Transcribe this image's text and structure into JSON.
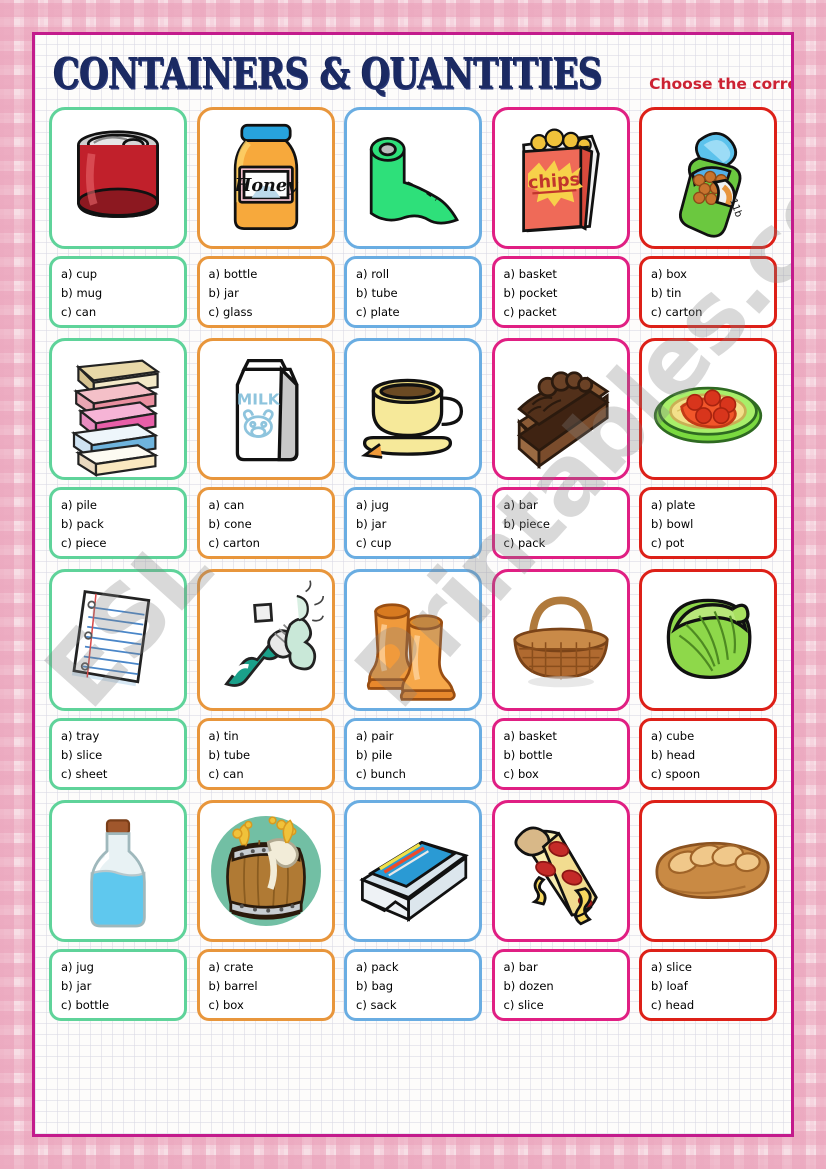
{
  "header": {
    "title": "CONTAINERS & QUANTITIES",
    "instruction": "Choose the correct option."
  },
  "watermark": {
    "left": "ESL",
    "right": "Printables.com"
  },
  "colors": {
    "title": "#1b2a63",
    "instruction": "#cc2233",
    "frame": "#c31b8c",
    "border_green": "#5fd39a",
    "border_orange": "#e8963c",
    "border_blue": "#6aade2",
    "border_pink": "#e01f83",
    "border_red": "#dd2018"
  },
  "rows": [
    {
      "cells": [
        {
          "border": "green",
          "picture": "red-can-icon",
          "picture_label": "red tin can with ring-pull lid",
          "options": [
            "a) cup",
            "b) mug",
            "c) can"
          ]
        },
        {
          "border": "orange",
          "picture": "honey-jar-icon",
          "picture_label": "honey jar with blue lid",
          "picture_text": "Honey",
          "options": [
            "a) bottle",
            "b) jar",
            "c) glass"
          ]
        },
        {
          "border": "blue",
          "picture": "toilet-roll-icon",
          "picture_label": "green roll of paper",
          "options": [
            "a) roll",
            "b) tube",
            "c) plate"
          ]
        },
        {
          "border": "pink",
          "picture": "chips-packet-icon",
          "picture_label": "open red packet of chips",
          "picture_text": "chips",
          "options": [
            "a) basket",
            "b) pocket",
            "c) packet"
          ]
        },
        {
          "border": "red",
          "picture": "open-bean-tin-icon",
          "picture_label": "opened green tin of beans",
          "options": [
            "a) box",
            "b) tin",
            "c) carton"
          ]
        }
      ]
    },
    {
      "cells": [
        {
          "border": "green",
          "picture": "stack-of-boxes-icon",
          "picture_label": "pile of stacked boxes",
          "options": [
            "a) pile",
            "b) pack",
            "c) piece"
          ]
        },
        {
          "border": "orange",
          "picture": "milk-carton-icon",
          "picture_label": "milk carton with cow face",
          "picture_text": "MILK",
          "options": [
            "a) can",
            "b) cone",
            "c) carton"
          ]
        },
        {
          "border": "blue",
          "picture": "teacup-icon",
          "picture_label": "yellow cup and saucer",
          "options": [
            "a) jug",
            "b) jar",
            "c) cup"
          ]
        },
        {
          "border": "pink",
          "picture": "cake-slice-icon",
          "picture_label": "slice of chocolate layer cake",
          "options": [
            "a) bar",
            "b) piece",
            "c) pack"
          ]
        },
        {
          "border": "red",
          "picture": "spaghetti-plate-icon",
          "picture_label": "green plate of spaghetti with meatballs",
          "options": [
            "a) plate",
            "b) bowl",
            "c) pot"
          ]
        }
      ]
    },
    {
      "cells": [
        {
          "border": "green",
          "picture": "paper-sheet-icon",
          "picture_label": "sheet of lined notebook paper",
          "options": [
            "a) tray",
            "b) slice",
            "c) sheet"
          ]
        },
        {
          "border": "orange",
          "picture": "toothpaste-tube-icon",
          "picture_label": "squeezed toothpaste tube",
          "options": [
            "a) tin",
            "b) tube",
            "c) can"
          ]
        },
        {
          "border": "blue",
          "picture": "boots-icon",
          "picture_label": "pair of orange rubber boots",
          "options": [
            "a) pair",
            "b) pile",
            "c) bunch"
          ]
        },
        {
          "border": "pink",
          "picture": "wicker-basket-icon",
          "picture_label": "wicker basket with handle",
          "options": [
            "a) basket",
            "b) bottle",
            "c) box"
          ]
        },
        {
          "border": "red",
          "picture": "cabbage-icon",
          "picture_label": "head of green cabbage",
          "options": [
            "a) cube",
            "b) head",
            "c) spoon"
          ]
        }
      ]
    },
    {
      "cells": [
        {
          "border": "green",
          "picture": "corked-bottle-icon",
          "picture_label": "corked bottle with blue liquid",
          "options": [
            "a) jug",
            "b) jar",
            "c) bottle"
          ]
        },
        {
          "border": "orange",
          "picture": "barrel-icon",
          "picture_label": "wooden barrel overflowing with beer",
          "options": [
            "a) crate",
            "b) barrel",
            "c) box"
          ]
        },
        {
          "border": "blue",
          "picture": "card-pack-icon",
          "picture_label": "blue and white pack box",
          "options": [
            "a) pack",
            "b) bag",
            "c) sack"
          ]
        },
        {
          "border": "pink",
          "picture": "pizza-slice-icon",
          "picture_label": "slice of pepperoni pizza",
          "options": [
            "a) bar",
            "b) dozen",
            "c) slice"
          ]
        },
        {
          "border": "red",
          "picture": "bread-loaf-icon",
          "picture_label": "loaf of bread",
          "options": [
            "a) slice",
            "b) loaf",
            "c) head"
          ]
        }
      ]
    }
  ]
}
